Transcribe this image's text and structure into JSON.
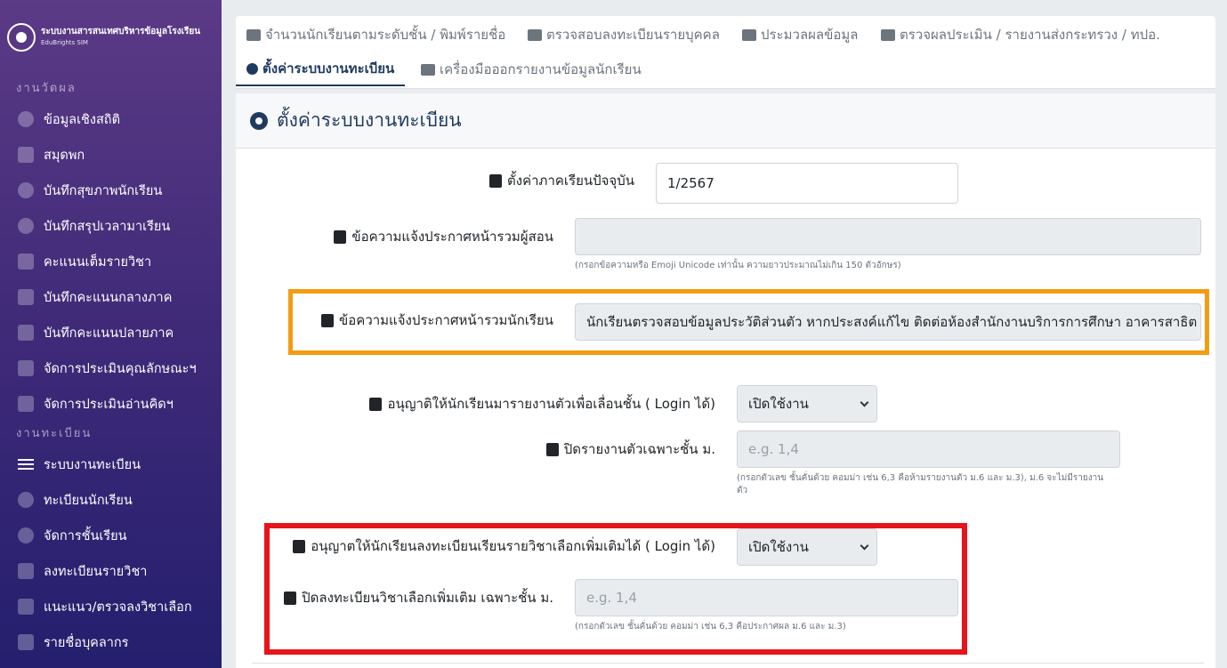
{
  "sidebar": {
    "brand_title": "ระบบงานสารสนเทศบริหารข้อมูลโรงเรียน",
    "brand_sub": "EduBrights SIM",
    "sections": [
      {
        "label": "งานวัดผล",
        "items": [
          {
            "label": "ข้อมูลเชิงสถิติ",
            "icon": "pie-chart-icon"
          },
          {
            "label": "สมุดพก",
            "icon": "book-icon"
          },
          {
            "label": "บันทึกสุขภาพนักเรียน",
            "icon": "shield-icon"
          },
          {
            "label": "บันทึกสรุปเวลามาเรียน",
            "icon": "shield-icon"
          },
          {
            "label": "คะแนนเต็มรายวิชา",
            "icon": "book-icon"
          },
          {
            "label": "บันทึกคะแนนกลางภาค",
            "icon": "book-icon"
          },
          {
            "label": "บันทึกคะแนนปลายภาค",
            "icon": "book-icon"
          },
          {
            "label": "จัดการประเมินคุณลักษณะฯ",
            "icon": "book-icon"
          },
          {
            "label": "จัดการประเมินอ่านคิดฯ",
            "icon": "book-icon"
          }
        ]
      },
      {
        "label": "งานทะเบียน",
        "items": [
          {
            "label": "ระบบงานทะเบียน",
            "icon": "list-icon"
          },
          {
            "label": "ทะเบียนนักเรียน",
            "icon": "face-icon"
          },
          {
            "label": "จัดการชั้นเรียน",
            "icon": "users-icon"
          },
          {
            "label": "ลงทะเบียนรายวิชา",
            "icon": "checklist-icon"
          },
          {
            "label": "แนะแนว/ตรวจลงวิชาเลือก",
            "icon": "star-icon"
          },
          {
            "label": "รายชื่อบุคลากร",
            "icon": "id-badge-icon"
          }
        ]
      }
    ]
  },
  "tabs": [
    {
      "label": "จำนวนนักเรียนตามระดับชั้น / พิมพ์รายชื่อ",
      "icon": "users-icon"
    },
    {
      "label": "ตรวจสอบลงทะเบียนรายบุคคล",
      "icon": "id-card-icon"
    },
    {
      "label": "ประมวลผลข้อมูล",
      "icon": "calculator-icon"
    },
    {
      "label": "ตรวจผลประเมิน / รายงานส่งกระทรวง / ทปอ.",
      "icon": "table-icon"
    },
    {
      "label": "ตั้งค่าระบบงานทะเบียน",
      "icon": "gear-icon"
    },
    {
      "label": "เครื่องมือออกรายงานข้อมูลนักเรียน",
      "icon": "print-icon"
    }
  ],
  "panel": {
    "title": "ตั้งค่าระบบงานทะเบียน",
    "semester": {
      "label": "ตั้งค่าภาคเรียนปัจจุบัน",
      "value": "1/2567"
    },
    "teacher_announce": {
      "label": "ข้อความแจ้งประกาศหน้ารวมผู้สอน",
      "value": "",
      "help": "(กรอกข้อความหรือ Emoji Unicode เท่านั้น ความยาวประมาณไม่เกิน 150 ตัวอักษร)"
    },
    "student_announce": {
      "label": "ข้อความแจ้งประกาศหน้ารวมนักเรียน",
      "value": "นักเรียนตรวจสอบข้อมูลประวัติส่วนตัว หากประสงค์แก้ไข ติดต่อห้องสำนักงานบริการการศึกษา อาคารสาธิต"
    },
    "report_allow": {
      "label": "อนุญาติให้นักเรียนมารายงานตัวเพื่อเลื่อนชั้น ( Login ได้)",
      "value": "เปิดใช้งาน"
    },
    "report_close": {
      "label": "ปิดรายงานตัวเฉพาะชั้น ม.",
      "placeholder": "e.g. 1,4",
      "help_1": "(กรอกตัวเลข ชั้นคั่นด้วย คอมม่า เช่น 6,3 คือห้ามรายงานตัว ม.6 และ ม.3), ม.6 จะไม่มีรายงาน",
      "help_2": "ตัว"
    },
    "elective_allow": {
      "label": "อนุญาตให้นักเรียนลงทะเบียนเรียนรายวิชาเลือกเพิ่มเติมได้ ( Login ได้)",
      "value": "เปิดใช้งาน"
    },
    "elective_close": {
      "label": "ปิดลงทะเบียนวิชาเลือกเพิ่มเติม เฉพาะชั้น ม.",
      "placeholder": "e.g. 1,4",
      "help": "(กรอกตัวเลข ชั้นคั่นด้วย คอมม่า เช่น 6,3 คือประกาศผล ม.6 และ ม.3)"
    }
  },
  "colors": {
    "highlight_orange": "#f39c12",
    "highlight_red": "#e8141b",
    "accent": "#1f3a5f"
  }
}
